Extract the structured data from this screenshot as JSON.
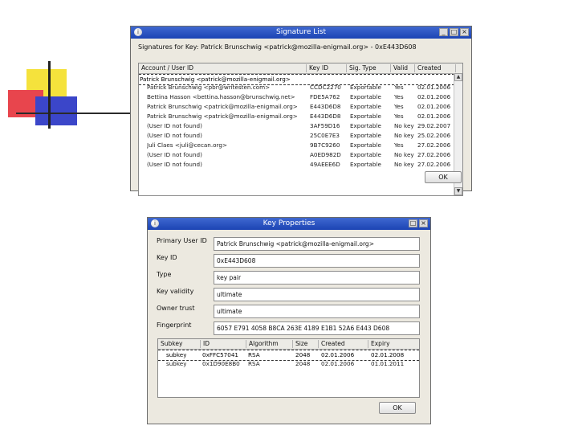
{
  "signature_list": {
    "title": "Signature List",
    "heading": "Signatures for Key:  Patrick Brunschwig <patrick@mozilla-enigmail.org> - 0xE443D608",
    "columns": [
      "Account / User ID",
      "Key ID",
      "Sig. Type",
      "Valid",
      "Created"
    ],
    "rows": [
      {
        "user": "Patrick Brunschwig <patrick@mozilla-enigmail.org>",
        "key_id": "",
        "sig_type": "",
        "valid": "",
        "created": ""
      },
      {
        "user": "Patrick Brunschwig <pbr@writesten.com>",
        "key_id": "CCDC2270",
        "sig_type": "Exportable",
        "valid": "Yes",
        "created": "02.01.2006"
      },
      {
        "user": "Bettina Hasson <bettina.hasson@brunschwig.net>",
        "key_id": "FDE5A762",
        "sig_type": "Exportable",
        "valid": "Yes",
        "created": "02.01.2006"
      },
      {
        "user": "Patrick Brunschwig <patrick@mozilla-enigmail.org>",
        "key_id": "E443D6D8",
        "sig_type": "Exportable",
        "valid": "Yes",
        "created": "02.01.2006"
      },
      {
        "user": "Patrick Brunschwig <patrick@mozilla-enigmail.org>",
        "key_id": "E443D6D8",
        "sig_type": "Exportable",
        "valid": "Yes",
        "created": "02.01.2006"
      },
      {
        "user": "(User ID not found)",
        "key_id": "3AF59D16",
        "sig_type": "Exportable",
        "valid": "No key",
        "created": "29.02.2007"
      },
      {
        "user": "(User ID not found)",
        "key_id": "25C0E7E3",
        "sig_type": "Exportable",
        "valid": "No key",
        "created": "25.02.2006"
      },
      {
        "user": "Juli Claes <juli@cecan.org>",
        "key_id": "9B7C9260",
        "sig_type": "Exportable",
        "valid": "Yes",
        "created": "27.02.2006"
      },
      {
        "user": "(User ID not found)",
        "key_id": "A0ED982D",
        "sig_type": "Exportable",
        "valid": "No key",
        "created": "27.02.2006"
      },
      {
        "user": "(User ID not found)",
        "key_id": "49AEEE6D",
        "sig_type": "Exportable",
        "valid": "No key",
        "created": "27.02.2006"
      }
    ],
    "ok_label": "OK"
  },
  "key_properties": {
    "title": "Key Properties",
    "primary_user_id_label": "Primary User ID",
    "primary_user_id": "Patrick Brunschwig <patrick@mozilla-enigmail.org>",
    "key_id_label": "Key ID",
    "key_id": "0xE443D608",
    "type_label": "Type",
    "type": "key pair",
    "key_validity_label": "Key validity",
    "key_validity": "ultimate",
    "owner_trust_label": "Owner trust",
    "owner_trust": "ultimate",
    "fingerprint_label": "Fingerprint",
    "fingerprint": "6057 E791 4058 B8CA 263E 4189 E1B1 52A6 E443 D608",
    "sub_columns": [
      "Subkey",
      "ID",
      "Algorithm",
      "Size",
      "Created",
      "Expiry"
    ],
    "subkeys": [
      {
        "subkey": "subkey",
        "id": "0xFFC57041",
        "algorithm": "RSA",
        "size": "2048",
        "created": "02.01.2006",
        "expiry": "02.01.2008"
      },
      {
        "subkey": "subkey",
        "id": "0x1D90E8B0",
        "algorithm": "RSA",
        "size": "2048",
        "created": "02.01.2006",
        "expiry": "01.01.2011"
      }
    ],
    "ok_label": "OK"
  },
  "window_buttons": {
    "minimize": "_",
    "maximize": "□",
    "close": "×"
  },
  "title_icon": "i",
  "colors": {
    "titlebar": "#1c44b4",
    "window_bg": "#ece9e0"
  }
}
